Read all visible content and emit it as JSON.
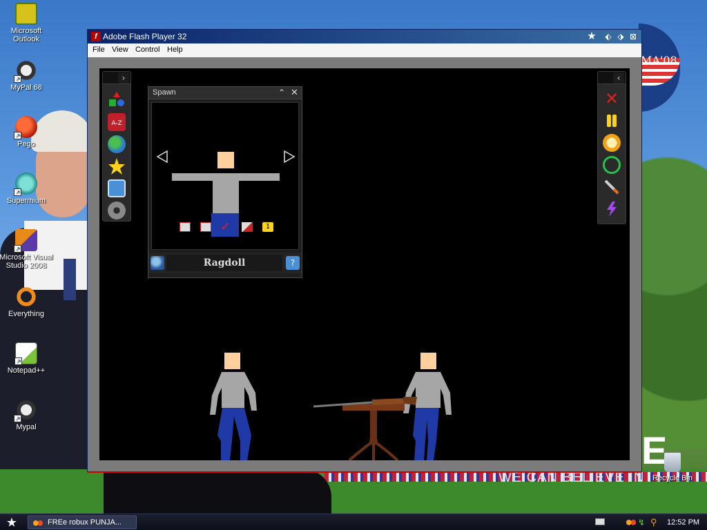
{
  "window": {
    "title": "Adobe Flash Player 32",
    "menu": [
      "File",
      "View",
      "Control",
      "Help"
    ]
  },
  "desktop_icons": [
    {
      "label": "Microsoft\nOutlook",
      "icon": "outlook-icon"
    },
    {
      "label": "MyPal 68",
      "icon": "mypal-icon"
    },
    {
      "label": "Pego",
      "icon": "pego-icon"
    },
    {
      "label": "Supermium",
      "icon": "supermium-icon"
    },
    {
      "label": "Microsoft Visual\nStudio 2008",
      "icon": "visual-studio-icon"
    },
    {
      "label": "Everything",
      "icon": "everything-icon"
    },
    {
      "label": "Notepad++",
      "icon": "notepadpp-icon"
    },
    {
      "label": "Mypal",
      "icon": "mypal-icon"
    }
  ],
  "recycle_bin": {
    "label": "Recycle Bin"
  },
  "wallpaper": {
    "logo_text": "MA'08",
    "slogan": "WE CAN BELIEVE IN",
    "big_letter": "E"
  },
  "spawn_panel": {
    "title": "Spawn",
    "item_name": "Ragdoll",
    "count_badge": "1"
  },
  "taskbar": {
    "task_label": "FREe robux PUNJA...",
    "clock": "12:52 PM"
  },
  "colors": {
    "titlebar": "#0a246a",
    "stage": "#000000",
    "skin": "#ffcf9e",
    "shirt": "#a6a6a6",
    "pants": "#1f3aa6"
  }
}
